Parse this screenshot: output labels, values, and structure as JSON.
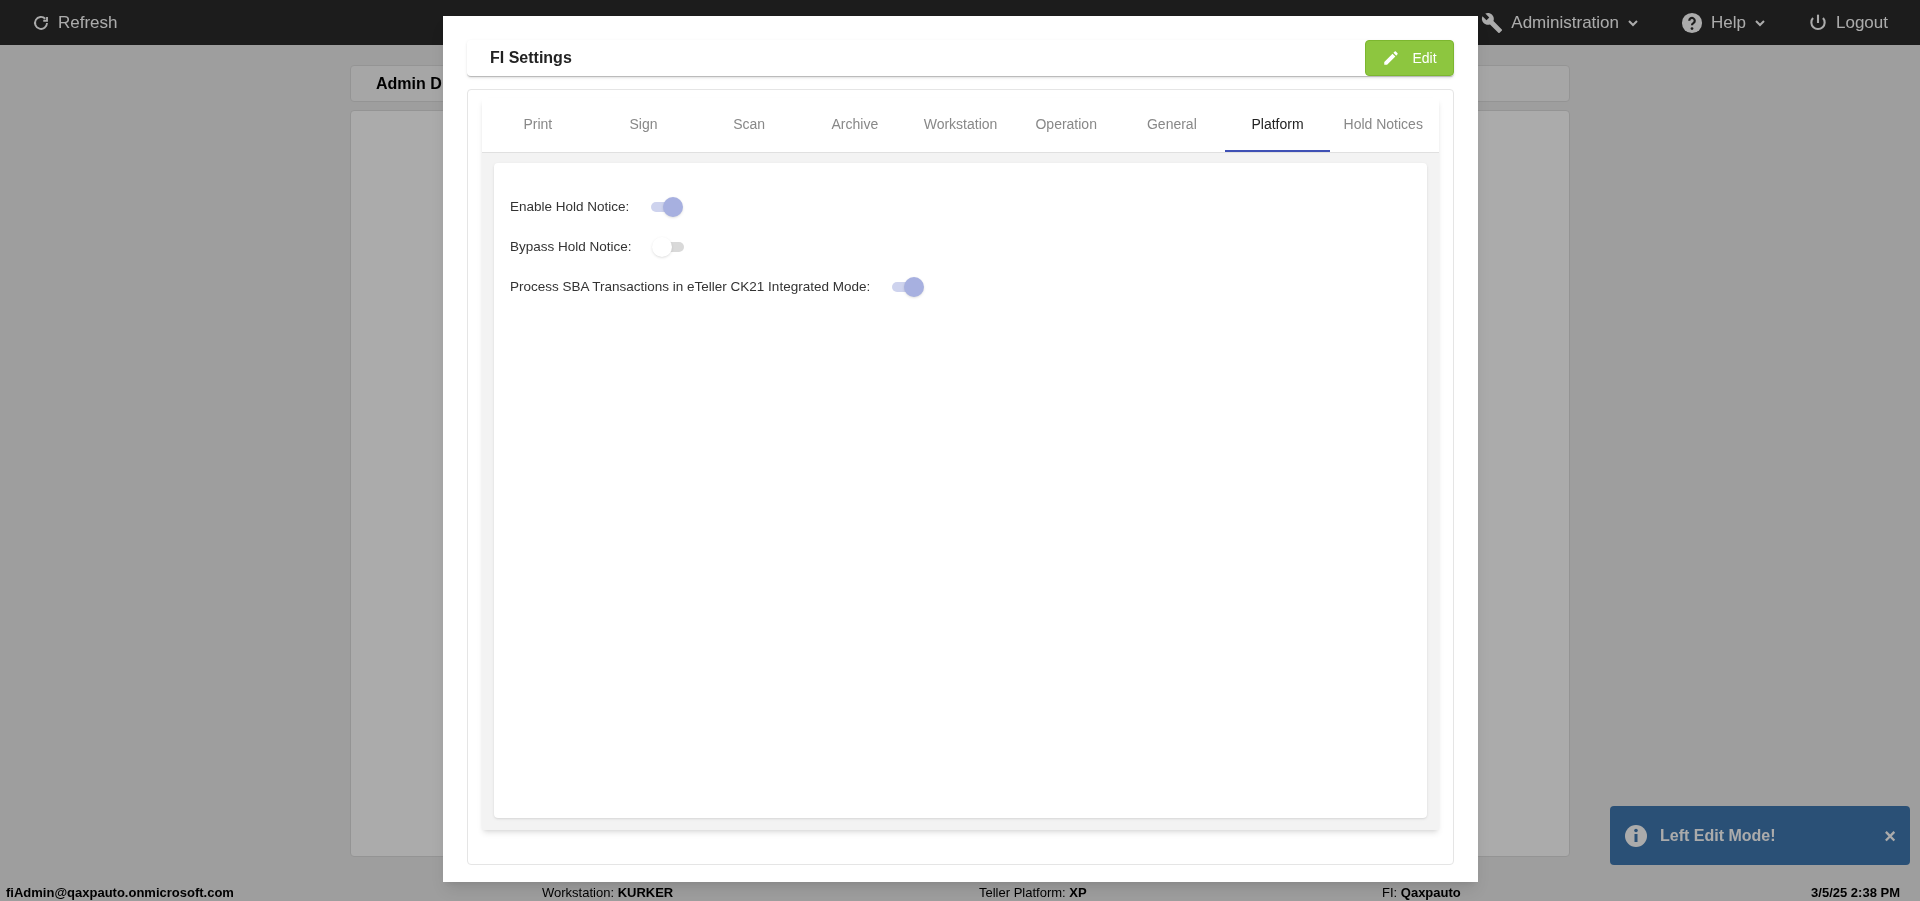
{
  "top_bar": {
    "refresh": "Refresh",
    "menus": [
      {
        "label": "Administration",
        "dropdown": true
      },
      {
        "label": "Help",
        "dropdown": true
      },
      {
        "label": "Logout",
        "dropdown": false
      }
    ]
  },
  "background_card": {
    "title": "Admin D"
  },
  "dialog": {
    "title": "FI Settings",
    "edit_button": "Edit",
    "tabs": [
      {
        "label": "Print",
        "selected": false
      },
      {
        "label": "Sign",
        "selected": false
      },
      {
        "label": "Scan",
        "selected": false
      },
      {
        "label": "Archive",
        "selected": false
      },
      {
        "label": "Workstation",
        "selected": false
      },
      {
        "label": "Operation",
        "selected": false
      },
      {
        "label": "General",
        "selected": false
      },
      {
        "label": "Platform",
        "selected": true
      },
      {
        "label": "Hold Notices",
        "selected": false
      }
    ],
    "settings": [
      {
        "label": "Enable Hold Notice:",
        "on": true
      },
      {
        "label": "Bypass Hold Notice:",
        "on": false
      },
      {
        "label": "Process SBA Transactions in eTeller CK21 Integrated Mode:",
        "on": true
      }
    ]
  },
  "toast": {
    "message": "Left Edit Mode!",
    "close": "×"
  },
  "status_bar": {
    "user": "fiAdmin@qaxpauto.onmicrosoft.com",
    "fields": [
      {
        "label": "Workstation:",
        "value": "KURKER"
      },
      {
        "label": "Teller Platform:",
        "value": "XP"
      },
      {
        "label": "FI:",
        "value": "Qaxpauto"
      }
    ],
    "datetime": "3/5/25 2:38 PM"
  }
}
